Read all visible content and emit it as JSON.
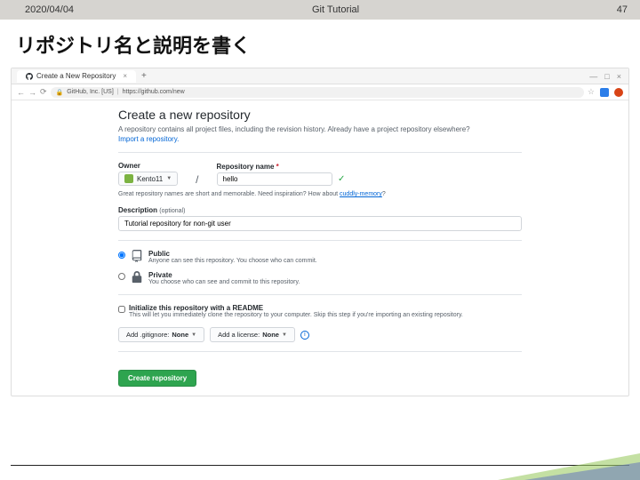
{
  "slide": {
    "date": "2020/04/04",
    "title": "Git Tutorial",
    "page": "47",
    "heading": "リポジトリ名と説明を書く"
  },
  "browser": {
    "tab_title": "Create a New Repository",
    "url_host": "GitHub, Inc. [US]",
    "url_path": "https://github.com/new"
  },
  "github": {
    "title": "Create a new repository",
    "subtitle_pre": "A repository contains all project files, including the revision history. Already have a project repository elsewhere?",
    "import_link": "Import a repository.",
    "owner_label": "Owner",
    "repo_label": "Repository name",
    "owner_name": "Kento11",
    "repo_name": "hello",
    "hint_pre": "Great repository names are short and memorable. Need inspiration? How about ",
    "hint_suggest": "cuddly-memory",
    "hint_post": "?",
    "description_label": "Description",
    "optional": "(optional)",
    "description_value": "Tutorial repository for non-git user",
    "public_title": "Public",
    "public_desc": "Anyone can see this repository. You choose who can commit.",
    "private_title": "Private",
    "private_desc": "You choose who can see and commit to this repository.",
    "init_title": "Initialize this repository with a README",
    "init_desc": "This will let you immediately clone the repository to your computer. Skip this step if you're importing an existing repository.",
    "gitignore_pre": "Add .gitignore: ",
    "gitignore_val": "None",
    "license_pre": "Add a license: ",
    "license_val": "None",
    "create_btn": "Create repository"
  }
}
